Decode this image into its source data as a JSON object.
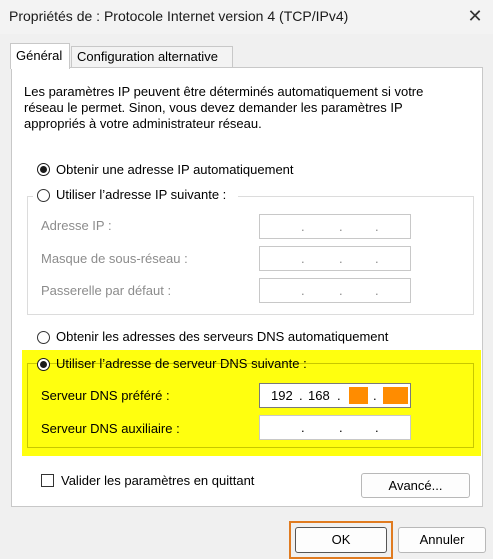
{
  "window": {
    "title": "Propriétés de : Protocole Internet version 4 (TCP/IPv4)",
    "close_glyph": "✕"
  },
  "tabs": [
    {
      "label": "Général"
    },
    {
      "label": "Configuration alternative"
    }
  ],
  "description": "Les paramètres IP peuvent être déterminés automatiquement si votre réseau le permet. Sinon, vous devez demander les paramètres IP appropriés à votre administrateur réseau.",
  "ip": {
    "auto_label": "Obtenir une adresse IP automatiquement",
    "manual_label": "Utiliser l’adresse IP suivante :",
    "selected": "auto",
    "fields": [
      {
        "label": "Adresse IP :",
        "value": ". . ."
      },
      {
        "label": "Masque de sous-réseau :",
        "value": ". . ."
      },
      {
        "label": "Passerelle par défaut :",
        "value": ". . ."
      }
    ]
  },
  "dns": {
    "auto_label": "Obtenir les adresses des serveurs DNS automatiquement",
    "manual_label": "Utiliser l’adresse de serveur DNS suivante :",
    "selected": "manual",
    "preferred": {
      "label": "Serveur DNS préféré :",
      "octet1": "192",
      "octet2": "168",
      "octet3": "",
      "octet4": ""
    },
    "alternate": {
      "label": "Serveur DNS auxiliaire :"
    }
  },
  "validate": {
    "label": "Valider les paramètres en quittant",
    "checked": false
  },
  "buttons": {
    "advanced": "Avancé...",
    "ok": "OK",
    "cancel": "Annuler"
  },
  "colors": {
    "highlight": "#ffff0f",
    "redaction": "#ff8c00",
    "ok_frame": "#e07b20"
  }
}
